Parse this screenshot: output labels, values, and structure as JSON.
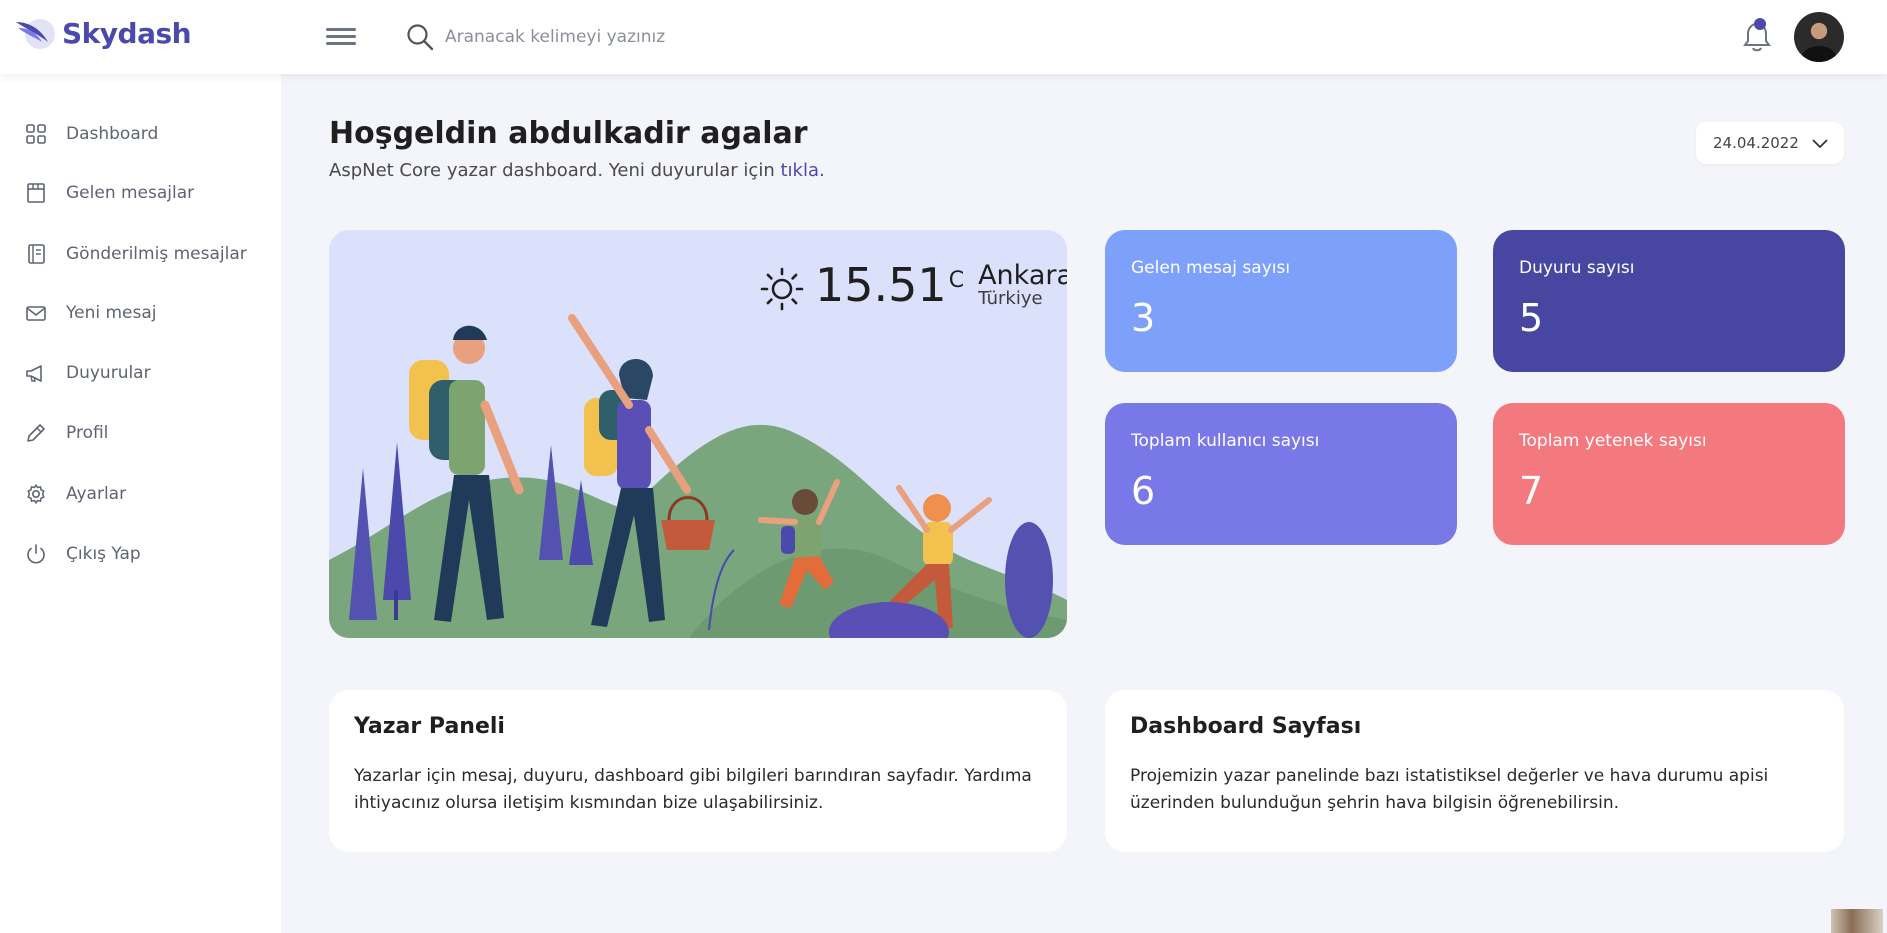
{
  "brand": {
    "name": "Skydash"
  },
  "search": {
    "placeholder": "Aranacak kelimeyi yazınız"
  },
  "sidebar": {
    "items": [
      {
        "label": "Dashboard",
        "icon": "grid-icon"
      },
      {
        "label": "Gelen mesajlar",
        "icon": "inbox-icon"
      },
      {
        "label": "Gönderilmiş mesajlar",
        "icon": "book-icon"
      },
      {
        "label": "Yeni mesaj",
        "icon": "mail-icon"
      },
      {
        "label": "Duyurular",
        "icon": "megaphone-icon"
      },
      {
        "label": "Profil",
        "icon": "pencil-icon"
      },
      {
        "label": "Ayarlar",
        "icon": "gear-icon"
      },
      {
        "label": "Çıkış Yap",
        "icon": "power-icon"
      }
    ]
  },
  "header": {
    "title": "Hoşgeldin abdulkadir agalar",
    "subtitle": "AspNet Core yazar dashboard. Yeni duyurular için",
    "link": "tıkla."
  },
  "date": {
    "value": "24.04.2022"
  },
  "weather": {
    "temp": "15.51",
    "unit": "C",
    "city": "Ankara",
    "country": "Türkiye"
  },
  "stats": [
    {
      "label": "Gelen mesaj sayısı",
      "value": "3",
      "color": "#7da0fa"
    },
    {
      "label": "Duyuru sayısı",
      "value": "5",
      "color": "#4747a1"
    },
    {
      "label": "Toplam kullanıcı sayısı",
      "value": "6",
      "color": "#7978e9"
    },
    {
      "label": "Toplam yetenek sayısı",
      "value": "7",
      "color": "#f3797e"
    }
  ],
  "cards": [
    {
      "title": "Yazar Paneli",
      "text": "Yazarlar için mesaj, duyuru, dashboard gibi bilgileri barındıran sayfadır. Yardıma ihtiyacınız olursa iletişim kısmından bize ulaşabilirsiniz."
    },
    {
      "title": "Dashboard Sayfası",
      "text": "Projemizin yazar panelinde bazı istatistiksel değerler ve hava durumu apisi üzerinden bulunduğun şehrin hava bilgisin öğrenebilirsin."
    }
  ],
  "colors": {
    "brand": "#4b49ac",
    "background": "#f4f5fa"
  }
}
